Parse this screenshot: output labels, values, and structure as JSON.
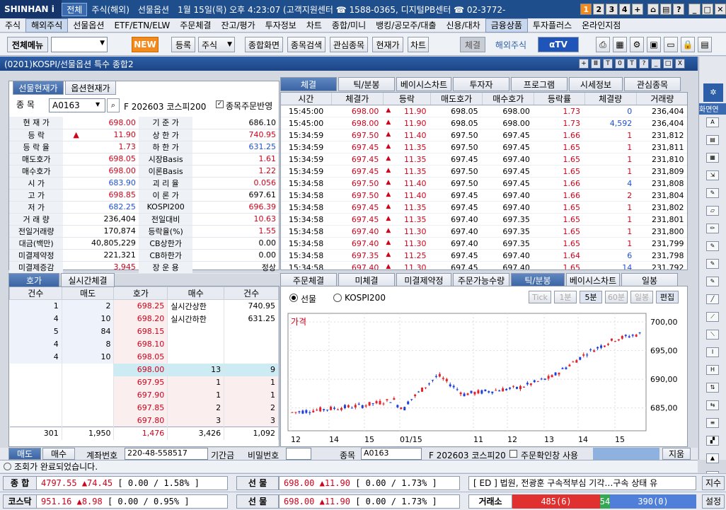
{
  "app": {
    "logo": "SHINHAN i",
    "tabs": [
      "전체",
      "주식(해외)",
      "선물옵션"
    ],
    "info": "1월 15일(목) 오후 4:23:07 (고객지원센터 ☎ 1588-0365, 디지털PB센터 ☎ 02-3772-",
    "nums": [
      "1",
      "2",
      "3",
      "4",
      "+"
    ]
  },
  "menu": [
    "주식",
    "해외주식",
    "선물옵션",
    "ETF/ETN/ELW",
    "주문체결",
    "잔고/평가",
    "투자정보",
    "차트",
    "종합/미니",
    "뱅킹/공모주/대출",
    "신용/대차",
    "금융상품",
    "투자플러스",
    "온라인지점"
  ],
  "toolbar": {
    "all_menu": "전체메뉴",
    "new": "NEW",
    "register": "등록",
    "stock": "주식",
    "btns": [
      "종합화면",
      "종목검색",
      "관심종목",
      "현재가",
      "차트"
    ],
    "exec": "체결",
    "overseas": "해외주식",
    "atv": "αTV"
  },
  "window": {
    "title": "(0201)KOSPI/선물옵션 특수 종합2",
    "ctls": [
      "+",
      "Ⅲ",
      "T",
      "0",
      "T",
      "?",
      "_",
      "□",
      "X"
    ]
  },
  "left": {
    "tabs": [
      "선물현재가",
      "옵션현재가"
    ],
    "code_label": "종  목",
    "code": "A0163",
    "name": "F 202603 코스피200",
    "reflect": "종목주문반영",
    "rows": [
      [
        "현 재 가",
        "",
        "698.00",
        "red",
        "기 준 가",
        "686.10",
        ""
      ],
      [
        "등   락",
        "▲",
        "11.90",
        "red",
        "상 한 가",
        "740.95",
        "red"
      ],
      [
        "등 락 율",
        "",
        "1.73",
        "red",
        "하 한 가",
        "631.25",
        "blue"
      ],
      [
        "매도호가",
        "",
        "698.05",
        "red",
        "시장Basis",
        "1.61",
        "red"
      ],
      [
        "매수호가",
        "",
        "698.00",
        "red",
        "이론Basis",
        "1.22",
        "red"
      ],
      [
        "시   가",
        "",
        "683.90",
        "blue",
        "괴 리 율",
        "0.056",
        "red"
      ],
      [
        "고   가",
        "",
        "698.85",
        "red",
        "이 론 가",
        "697.61",
        ""
      ],
      [
        "저   가",
        "",
        "682.25",
        "blue",
        "KOSPI200",
        "696.39",
        "red"
      ],
      [
        "거 래 량",
        "",
        "236,404",
        "",
        "전일대비",
        "10.63",
        "red"
      ],
      [
        "전일거래량",
        "",
        "170,874",
        "",
        "등락율(%)",
        "1.55",
        "red"
      ],
      [
        "대금(백만)",
        "",
        "40,805,229",
        "",
        "CB상한가",
        "0.00",
        ""
      ],
      [
        "미결제약정",
        "",
        "221,321",
        "",
        "CB하한가",
        "0.00",
        ""
      ],
      [
        "미결제증감",
        "",
        "3,945",
        "red",
        "장 운 용",
        "정상",
        ""
      ]
    ]
  },
  "tick": {
    "tabs": [
      "체결",
      "틱/분봉",
      "베이시스차트",
      "투자자",
      "프로그램",
      "시세정보",
      "관심종목"
    ],
    "headers": [
      "시간",
      "체결가",
      "등락",
      "매도호가",
      "매수호가",
      "등락률",
      "체결량",
      "거래량"
    ],
    "rows": [
      [
        "15:45:00",
        "698.00",
        "11.90",
        "698.05",
        "698.00",
        "1.73",
        "0",
        "236,404"
      ],
      [
        "15:45:00",
        "698.00",
        "11.90",
        "698.05",
        "698.00",
        "1.73",
        "4,592",
        "236,404"
      ],
      [
        "15:34:59",
        "697.50",
        "11.40",
        "697.50",
        "697.45",
        "1.66",
        "1",
        "231,812"
      ],
      [
        "15:34:59",
        "697.45",
        "11.35",
        "697.50",
        "697.45",
        "1.65",
        "1",
        "231,811"
      ],
      [
        "15:34:59",
        "697.45",
        "11.35",
        "697.45",
        "697.40",
        "1.65",
        "1",
        "231,810"
      ],
      [
        "15:34:59",
        "697.45",
        "11.35",
        "697.50",
        "697.45",
        "1.65",
        "1",
        "231,809"
      ],
      [
        "15:34:58",
        "697.50",
        "11.40",
        "697.50",
        "697.45",
        "1.66",
        "4",
        "231,808"
      ],
      [
        "15:34:58",
        "697.50",
        "11.40",
        "697.45",
        "697.40",
        "1.66",
        "2",
        "231,804"
      ],
      [
        "15:34:58",
        "697.45",
        "11.35",
        "697.45",
        "697.40",
        "1.65",
        "1",
        "231,802"
      ],
      [
        "15:34:58",
        "697.45",
        "11.35",
        "697.40",
        "697.35",
        "1.65",
        "1",
        "231,801"
      ],
      [
        "15:34:58",
        "697.40",
        "11.30",
        "697.40",
        "697.35",
        "1.65",
        "1",
        "231,800"
      ],
      [
        "15:34:58",
        "697.40",
        "11.30",
        "697.40",
        "697.35",
        "1.65",
        "1",
        "231,799"
      ],
      [
        "15:34:58",
        "697.35",
        "11.25",
        "697.45",
        "697.40",
        "1.64",
        "6",
        "231,798"
      ],
      [
        "15:34:58",
        "697.40",
        "11.30",
        "697.45",
        "697.40",
        "1.65",
        "14",
        "231,792"
      ]
    ]
  },
  "orderbook": {
    "tabs": [
      "호가",
      "실시간체결"
    ],
    "headers": [
      "건수",
      "매도",
      "호가",
      "매수",
      "건수"
    ],
    "asks": [
      [
        "1",
        "2",
        "698.25"
      ],
      [
        "4",
        "10",
        "698.20"
      ],
      [
        "5",
        "84",
        "698.15"
      ],
      [
        "4",
        "8",
        "698.10"
      ],
      [
        "4",
        "10",
        "698.05"
      ]
    ],
    "bids": [
      [
        "698.00",
        "13",
        "9"
      ],
      [
        "697.95",
        "1",
        "1"
      ],
      [
        "697.90",
        "1",
        "1"
      ],
      [
        "697.85",
        "2",
        "2"
      ],
      [
        "697.80",
        "3",
        "3"
      ]
    ],
    "upper_label": "실시간상한",
    "upper": "740.95",
    "lower_label": "실시간하한",
    "lower": "631.25",
    "totals": [
      "301",
      "1,950",
      "1,476",
      "3,426",
      "1,092"
    ]
  },
  "chartpanel": {
    "tabs": [
      "주문체결",
      "미체결",
      "미결제약정",
      "주문가능수량",
      "틱/분봉",
      "베이시스차트",
      "일봉"
    ],
    "radio1": "선물",
    "radio2": "KOSPI200",
    "period_btns": [
      "Tick",
      "1분",
      "5분",
      "60분",
      "일봉",
      "편집"
    ],
    "price_label": "가격"
  },
  "chart_data": {
    "type": "candlestick",
    "ylabel": "가격",
    "ylim": [
      681,
      701.5
    ],
    "yticks": [
      "700,00",
      "695,00",
      "690,00",
      "685,00"
    ],
    "xticks": [
      "12",
      "14",
      "15",
      "01/15",
      "11",
      "12",
      "13",
      "14",
      "15"
    ],
    "description_note": "5-minute candles, rising from ~684 to ~698"
  },
  "order_row": {
    "sell": "매도",
    "buy": "매수",
    "acct_label": "계좌번호",
    "acct": "220-48-558517",
    "deposit": "기간금",
    "pwd": "비밀번호",
    "code_label": "종목",
    "code": "A0163",
    "name": "F 202603 코스피20",
    "auto": "주문확인창 사용",
    "done": "지움"
  },
  "status": "조회가 완료되었습니다.",
  "bottom1": {
    "l1": "종  합",
    "v1": "4797.55",
    "c1": "▲74.45",
    "p1": "[ 0.00 / 1.58% ]",
    "l2": "선  물",
    "v2": "698.00",
    "c2": "▲11.90",
    "p2": "[ 0.00 / 1.73% ]",
    "news": "[ ED ] 법원, 전광훈 구속적부심 기각…구속 상태 유",
    "btn": "지수"
  },
  "bottom2": {
    "l1": "코스닥",
    "v1": "951.16",
    "c1": "▲8.98",
    "p1": "[ 0.00 / 0.95% ]",
    "l2": "선  물",
    "v2": "698.00",
    "c2": "▲11.90",
    "p2": "[ 0.00 / 1.73% ]",
    "ex": "거래소",
    "up": "485(6)",
    "flat": "54",
    "down": "390(0)",
    "btn": "설정"
  }
}
